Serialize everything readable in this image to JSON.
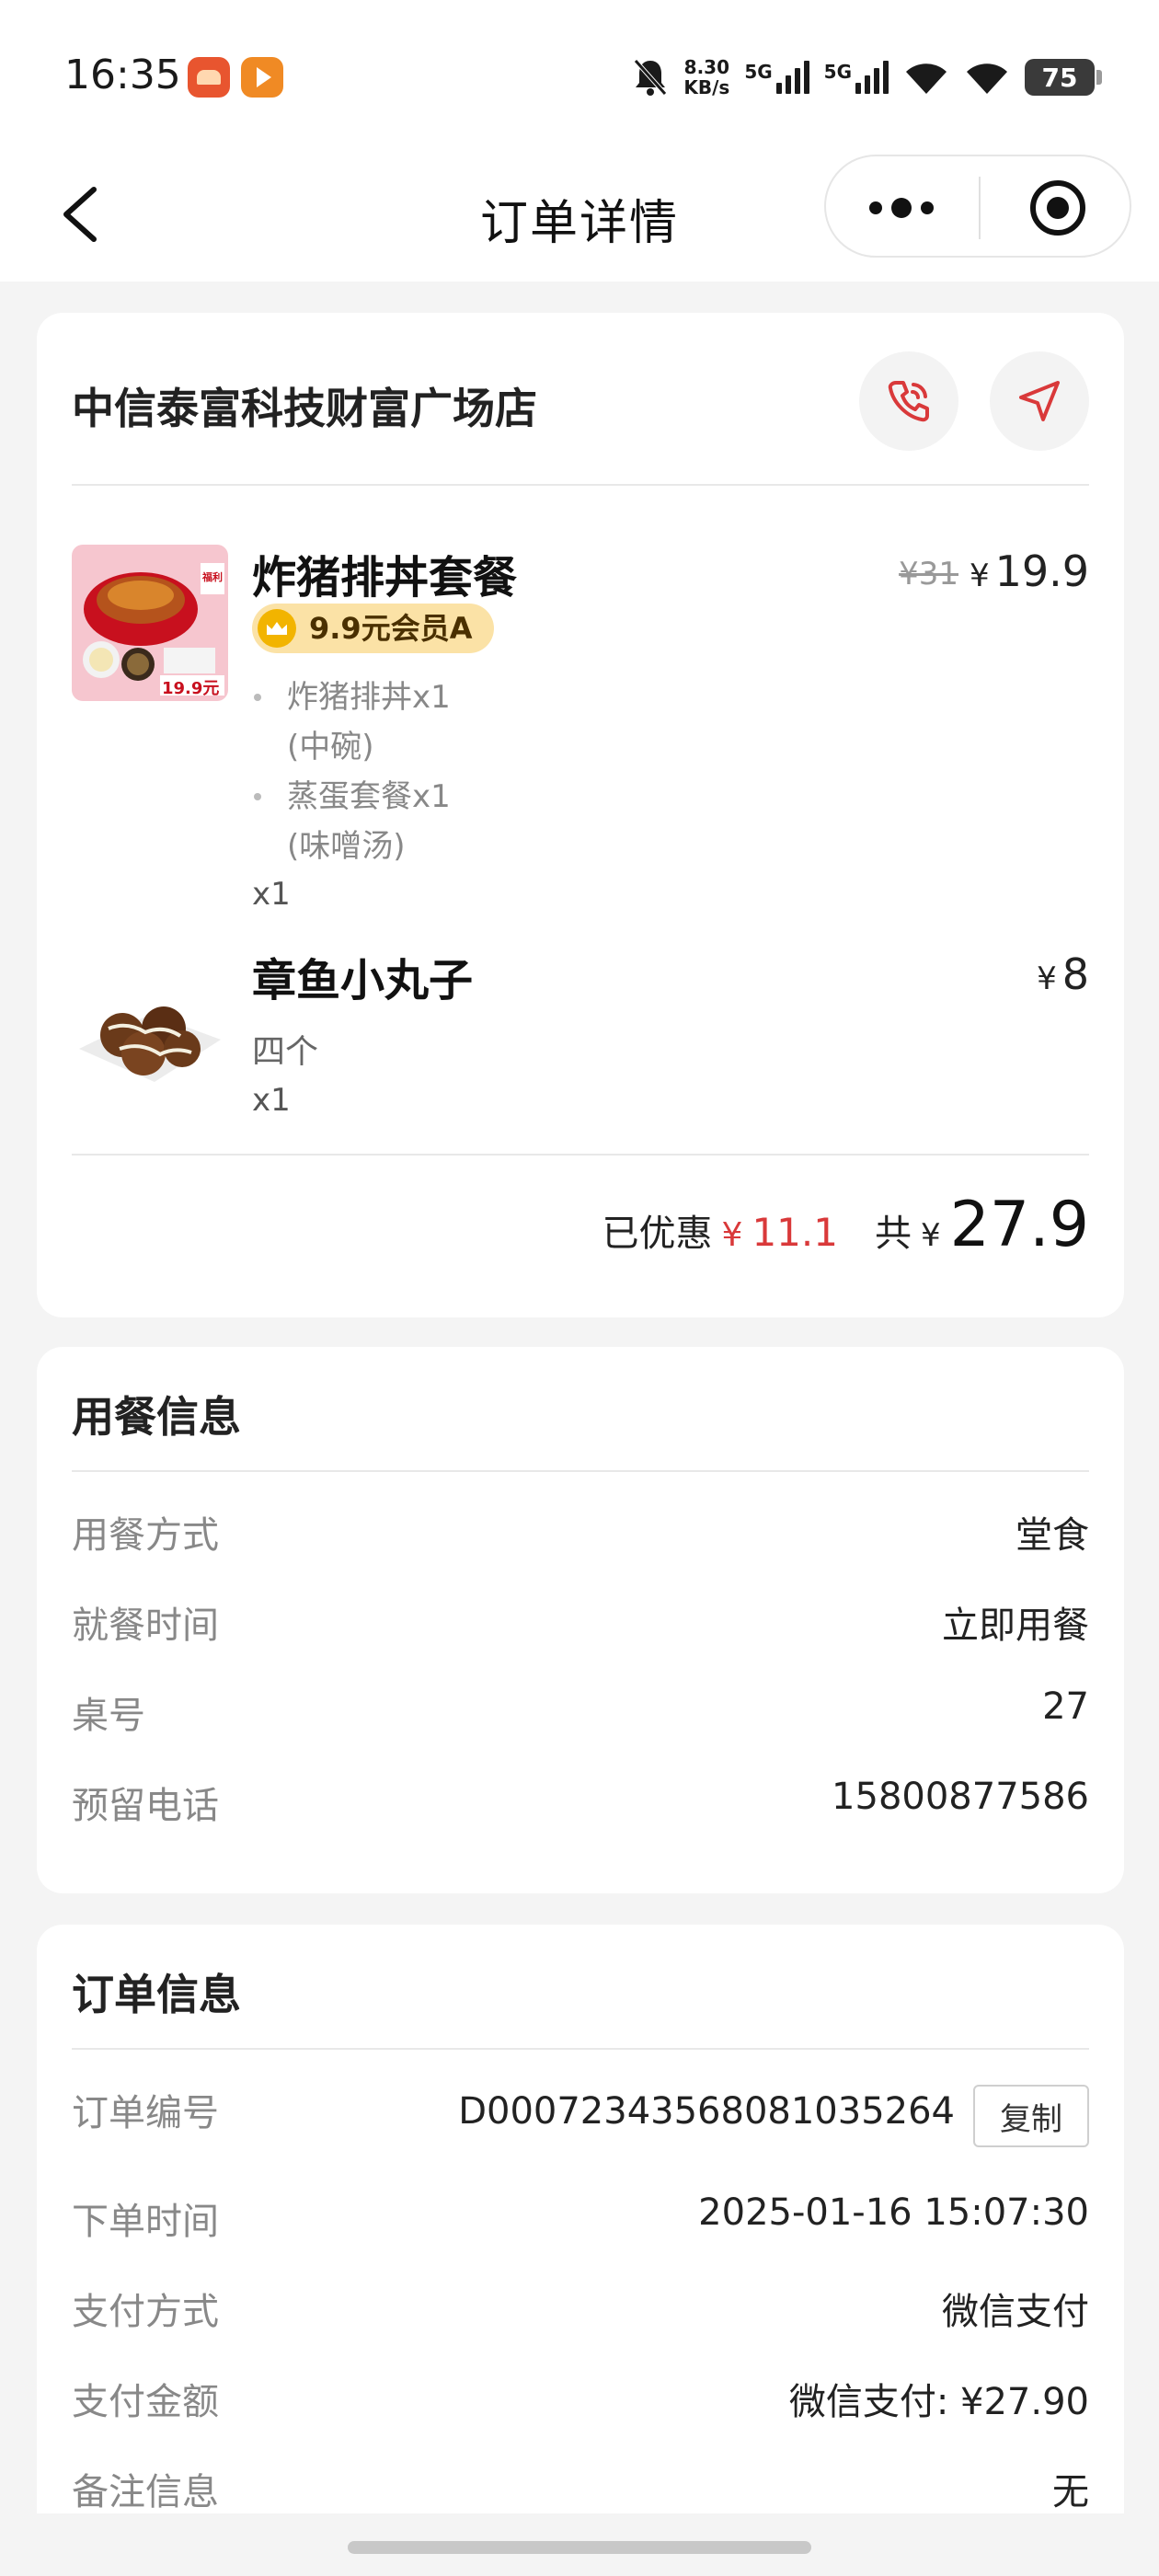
{
  "status_bar": {
    "time": "16:35",
    "net_speed_value": "8.30",
    "net_speed_unit": "KB/s",
    "sim1": "5G",
    "sim2": "5G",
    "battery": "75"
  },
  "nav": {
    "title": "订单详情"
  },
  "store": {
    "name": "中信泰富科技财富广场店"
  },
  "items": [
    {
      "name": "炸猪排丼套餐",
      "tag": "9.9元会员A",
      "subitems": [
        {
          "name": "炸猪排丼x1",
          "spec": "(中碗)"
        },
        {
          "name": "蒸蛋套餐x1",
          "spec": "(味噌汤)"
        }
      ],
      "qty": "x1",
      "old_price": "¥31",
      "price_symbol": "¥",
      "price": "19.9",
      "thumb_badge": "福利",
      "thumb_price": "19.9元"
    },
    {
      "name": "章鱼小丸子",
      "spec": "四个",
      "qty": "x1",
      "price_symbol": "¥",
      "price": "8"
    }
  ],
  "summary": {
    "discount_label": "已优惠",
    "discount_symbol": "¥",
    "discount_value": "11.1",
    "total_label": "共",
    "total_symbol": "¥",
    "total_value": "27.9"
  },
  "dining_info": {
    "title": "用餐信息",
    "rows": [
      {
        "label": "用餐方式",
        "value": "堂食"
      },
      {
        "label": "就餐时间",
        "value": "立即用餐"
      },
      {
        "label": "桌号",
        "value": "27"
      },
      {
        "label": "预留电话",
        "value": "15800877586"
      }
    ]
  },
  "order_info": {
    "title": "订单信息",
    "copy_label": "复制",
    "rows": [
      {
        "label": "订单编号",
        "value": "D00072343568081035264"
      },
      {
        "label": "下单时间",
        "value": "2025-01-16 15:07:30"
      },
      {
        "label": "支付方式",
        "value": "微信支付"
      },
      {
        "label": "支付金额",
        "value": "微信支付: ¥27.90"
      },
      {
        "label": "备注信息",
        "value": "无"
      }
    ]
  },
  "colors": {
    "accent_red": "#d9393a",
    "member_tag_bg": "#fbe2a6",
    "page_bg": "#f4f4f4"
  }
}
